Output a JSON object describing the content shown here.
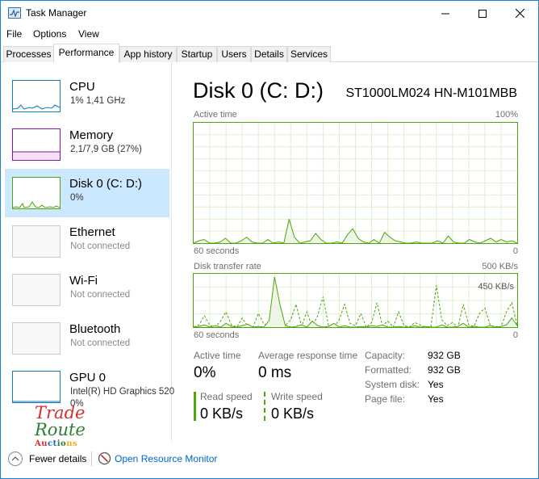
{
  "window": {
    "title": "Task Manager"
  },
  "menu": [
    "File",
    "Options",
    "View"
  ],
  "tabs": [
    "Processes",
    "Performance",
    "App history",
    "Startup",
    "Users",
    "Details",
    "Services"
  ],
  "active_tab": "Performance",
  "sidebar": {
    "items": [
      {
        "title": "CPU",
        "sub": "1% 1,41 GHz",
        "sub2": ""
      },
      {
        "title": "Memory",
        "sub": "2,1/7,9 GB (27%)",
        "sub2": ""
      },
      {
        "title": "Disk 0 (C: D:)",
        "sub": "0%",
        "sub2": ""
      },
      {
        "title": "Ethernet",
        "sub": "Not connected",
        "sub2": ""
      },
      {
        "title": "Wi-Fi",
        "sub": "Not connected",
        "sub2": ""
      },
      {
        "title": "Bluetooth",
        "sub": "Not connected",
        "sub2": ""
      },
      {
        "title": "GPU 0",
        "sub": "Intel(R) HD Graphics 520",
        "sub2": "0%"
      }
    ],
    "selected_index": 2
  },
  "watermark": {
    "line1": "Trade",
    "line2": "Route",
    "line3": "Auctions"
  },
  "main": {
    "title": "Disk 0 (C: D:)",
    "model": "ST1000LM024 HN-M101MBB",
    "active_chart": {
      "label": "Active time",
      "max_label": "100%",
      "time_label": "60 seconds",
      "min_label": "0",
      "values": [
        0,
        2,
        3,
        0,
        0,
        1,
        4,
        0,
        0,
        2,
        5,
        1,
        0,
        0,
        3,
        0,
        1,
        0,
        20,
        5,
        0,
        1,
        2,
        8,
        3,
        0,
        0,
        1,
        0,
        7,
        12,
        4,
        1,
        0,
        3,
        0,
        9,
        5,
        2,
        1,
        0,
        0,
        1,
        0,
        0,
        0,
        2,
        0,
        6,
        1,
        0,
        0,
        3,
        1,
        0,
        2,
        4,
        1,
        3,
        1,
        2,
        0
      ]
    },
    "transfer_chart": {
      "label": "Disk transfer rate",
      "max_label": "500 KB/s",
      "inner_label": "450 KB/s",
      "time_label": "60 seconds",
      "min_label": "0"
    },
    "stats": {
      "active_time_label": "Active time",
      "active_time_value": "0%",
      "response_label": "Average response time",
      "response_value": "0 ms",
      "read_label": "Read speed",
      "read_value": "0 KB/s",
      "write_label": "Write speed",
      "write_value": "0 KB/s"
    },
    "properties": [
      {
        "key": "Capacity:",
        "value": "932 GB"
      },
      {
        "key": "Formatted:",
        "value": "932 GB"
      },
      {
        "key": "System disk:",
        "value": "Yes"
      },
      {
        "key": "Page file:",
        "value": "Yes"
      }
    ]
  },
  "footer": {
    "fewer_details": "Fewer details",
    "resource_monitor": "Open Resource Monitor"
  },
  "colors": {
    "disk_green": "#4da60c",
    "link_blue": "#0066cc",
    "select_blue": "#cce8ff",
    "memory_purple": "#8b12ae",
    "cpu_blue": "#117dbb"
  }
}
